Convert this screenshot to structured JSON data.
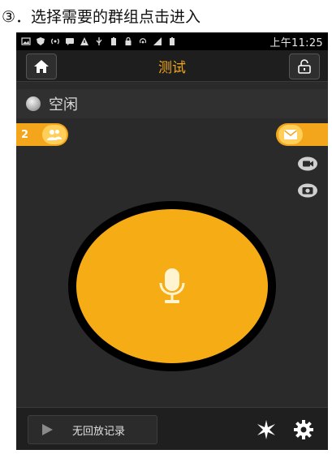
{
  "caption": {
    "text": "③．选择需要的群组点击进入"
  },
  "status_bar": {
    "time": "上午11:25",
    "icons": [
      "image-icon",
      "shield-icon",
      "broadcast-icon",
      "message-icon",
      "warning-icon",
      "usb-icon",
      "battery-saver-icon",
      "lock-icon",
      "hotspot-icon",
      "4g-signal-icon",
      "battery-icon"
    ]
  },
  "header": {
    "title": "测试",
    "home_icon": "home-icon",
    "lock_icon": "unlock-icon"
  },
  "status": {
    "label": "空闲",
    "color": "#bdbdbd"
  },
  "group": {
    "count": "2",
    "icon": "group-icon"
  },
  "message": {
    "icon": "envelope-icon"
  },
  "side": {
    "video_icon": "video-camera-icon",
    "camera_icon": "camera-icon"
  },
  "talk": {
    "icon": "microphone-icon"
  },
  "bottom": {
    "playback_label": "无回放记录",
    "play_icon": "play-icon",
    "effect_icon": "sparkle-icon",
    "settings_icon": "gear-icon"
  },
  "colors": {
    "accent": "#f3a51c",
    "background": "#2a2a2a",
    "title": "#f0a51b"
  }
}
